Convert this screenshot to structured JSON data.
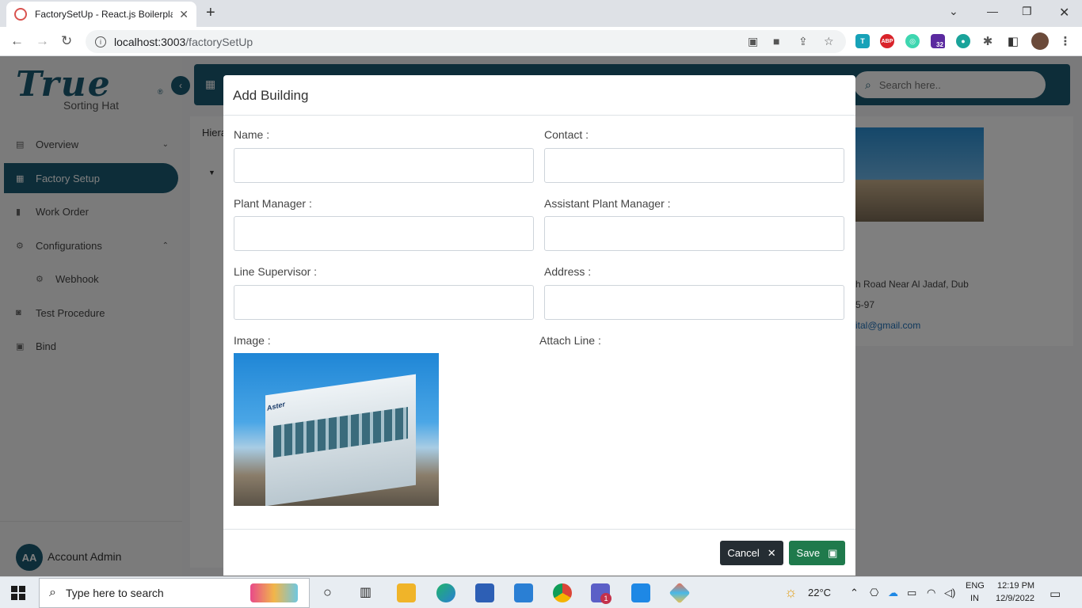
{
  "browser": {
    "tab_title": "FactorySetUp - React.js Boilerplat",
    "url_host": "localhost:3003",
    "url_path": "/factorySetUp",
    "ext_badge": "32"
  },
  "sidebar": {
    "logo": "True",
    "subtitle": "Sorting Hat",
    "items": [
      {
        "label": "Overview"
      },
      {
        "label": "Factory Setup"
      },
      {
        "label": "Work Order"
      },
      {
        "label": "Configurations"
      },
      {
        "label": "Webhook"
      },
      {
        "label": "Test Procedure"
      },
      {
        "label": "Bind"
      }
    ],
    "account_initials": "AA",
    "account_name": "Account Admin"
  },
  "main": {
    "search_placeholder": "Search here..",
    "hierarchy_label": "Hiera",
    "card_lines": [
      "h Road Near Al Jadaf, Dub",
      "5-97",
      "ital@gmail.com"
    ]
  },
  "modal": {
    "title": "Add Building",
    "fields": {
      "name": "Name :",
      "contact": "Contact :",
      "plant_manager": "Plant Manager :",
      "assistant_plant_manager": "Assistant Plant Manager :",
      "line_supervisor": "Line Supervisor :",
      "address": "Address :",
      "image": "Image :",
      "attach_line": "Attach Line :"
    },
    "image_sign": "Aster",
    "cancel_label": "Cancel",
    "save_label": "Save"
  },
  "taskbar": {
    "search_text": "Type here to search",
    "weather": "22°C",
    "lang_top": "ENG",
    "lang_bottom": "IN",
    "time": "12:19 PM",
    "date": "12/9/2022",
    "teams_badge": "1"
  },
  "colors": {
    "brand": "#1b5a72",
    "save": "#1f7a4c",
    "cancel": "#252d33"
  }
}
